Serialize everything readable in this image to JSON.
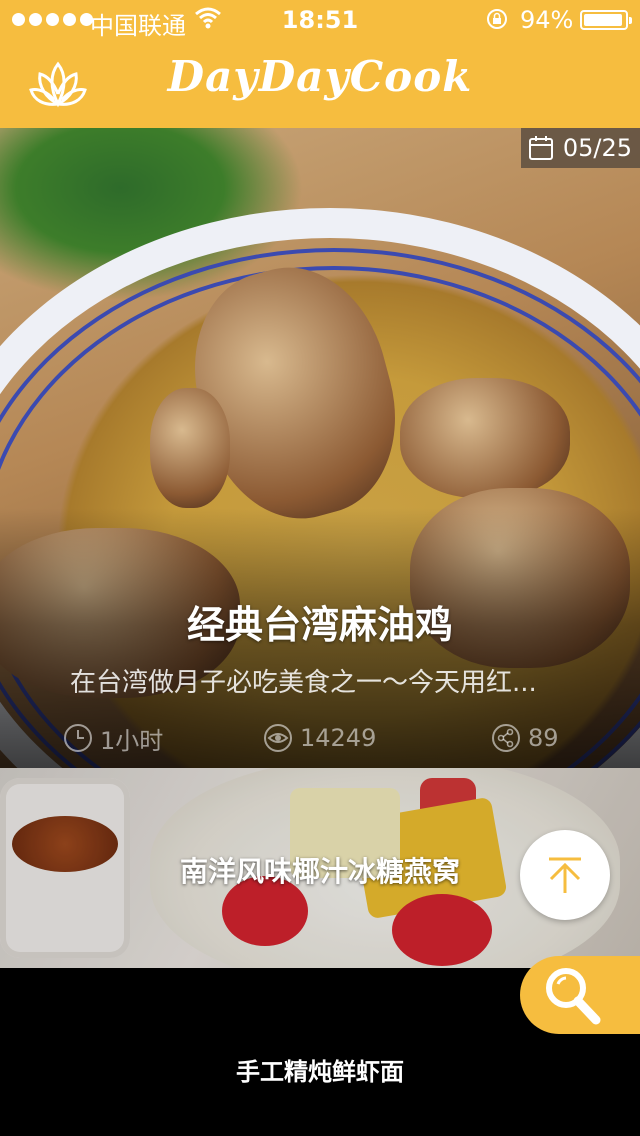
{
  "status_bar": {
    "carrier": "中国联通",
    "time": "18:51",
    "battery": "94%",
    "signal_icon": "signal-dots-icon",
    "wifi_icon": "wifi-icon",
    "lock_icon": "rotation-lock-icon",
    "battery_icon": "battery-icon",
    "battery_level": 0.94
  },
  "header": {
    "brand": "DayDayCook",
    "menu_icon": "lotus-icon",
    "background": "#f6bd3f"
  },
  "featured": {
    "date": "05/25",
    "date_icon": "calendar-icon",
    "title": "经典台湾麻油鸡",
    "description": "在台湾做月子必吃美食之一～今天用红...",
    "duration": "1小时",
    "views": "14249",
    "shares": "89",
    "duration_icon": "clock-icon",
    "views_icon": "eye-icon",
    "shares_icon": "share-icon"
  },
  "recipes": [
    {
      "title": "南洋风味椰汁冰糖燕窝"
    },
    {
      "title": "手工精炖鲜虾面"
    }
  ],
  "actions": {
    "back_to_top_icon": "arrow-up-icon",
    "search_icon": "search-icon"
  },
  "colors": {
    "accent": "#f6bd3f",
    "white": "#ffffff"
  }
}
